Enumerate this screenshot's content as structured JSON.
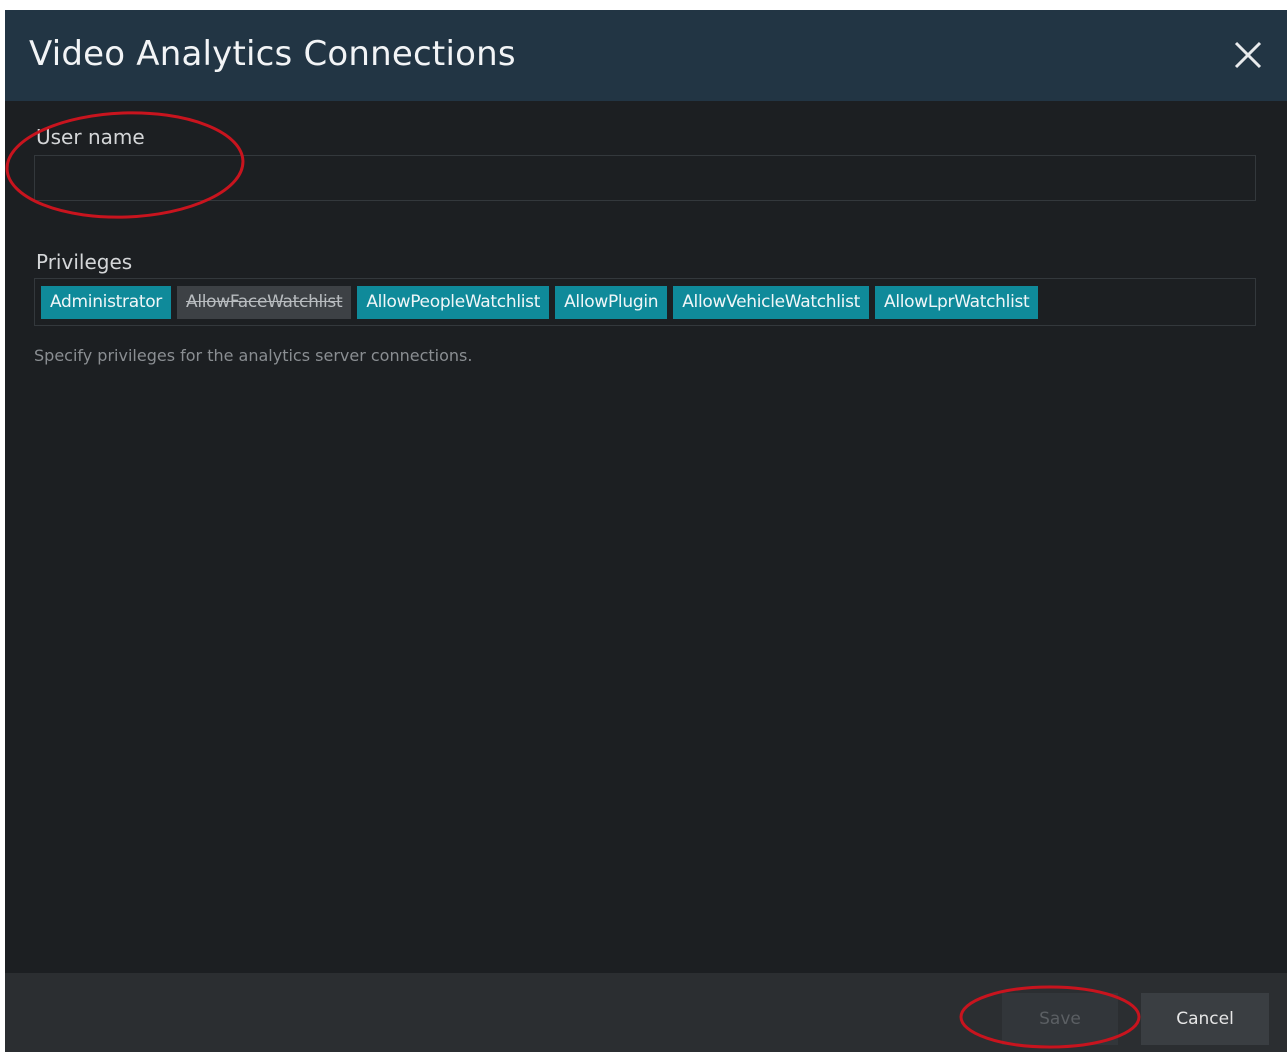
{
  "dialog": {
    "title": "Video Analytics Connections",
    "close_icon": "close-icon"
  },
  "form": {
    "username_label": "User name",
    "username_value": "",
    "privileges_label": "Privileges",
    "privileges": [
      {
        "label": "Administrator",
        "enabled": true
      },
      {
        "label": "AllowFaceWatchlist",
        "enabled": false
      },
      {
        "label": "AllowPeopleWatchlist",
        "enabled": true
      },
      {
        "label": "AllowPlugin",
        "enabled": true
      },
      {
        "label": "AllowVehicleWatchlist",
        "enabled": true
      },
      {
        "label": "AllowLprWatchlist",
        "enabled": true
      }
    ],
    "privileges_help": "Specify privileges for the analytics server connections."
  },
  "footer": {
    "save_label": "Save",
    "cancel_label": "Cancel"
  },
  "colors": {
    "header_bg": "#223544",
    "body_bg": "#1c1f22",
    "tag_active": "#0f8a9a",
    "tag_inactive": "#3d4145",
    "annotation": "#c8141e"
  }
}
